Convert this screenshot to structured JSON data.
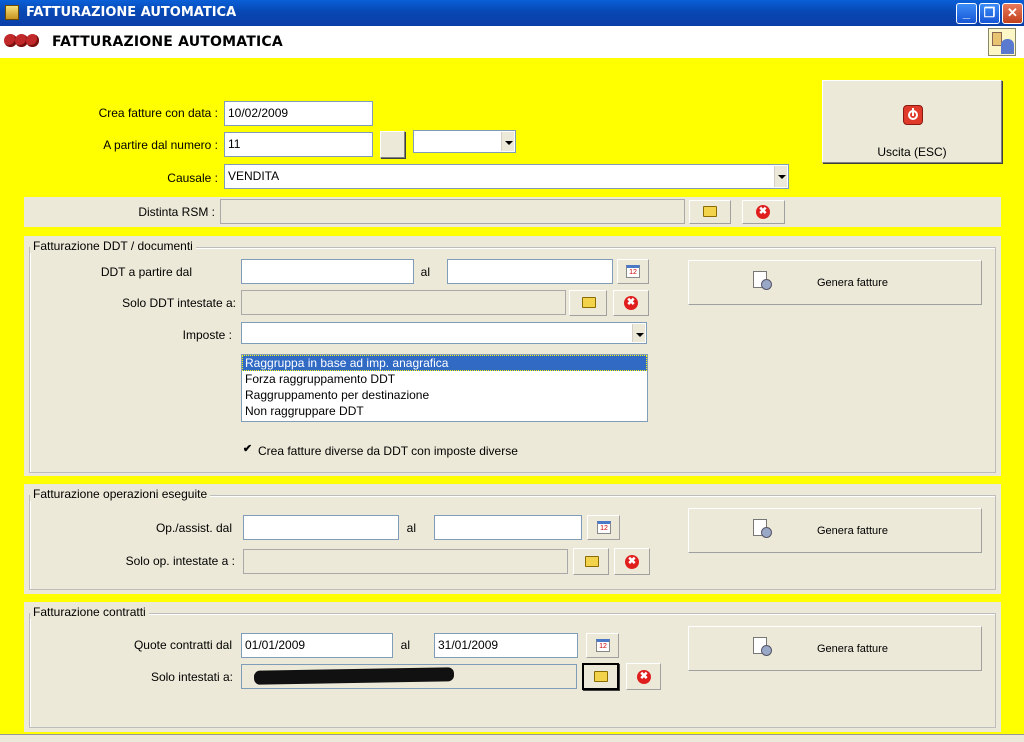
{
  "window": {
    "title": "FATTURAZIONE AUTOMATICA",
    "minimize": "_",
    "maximize": "❐",
    "close": "✕"
  },
  "header": {
    "title": "FATTURAZIONE AUTOMATICA",
    "logo_icon": "strawberries-logo-icon",
    "user_icon": "users-icon"
  },
  "top": {
    "date_label": "Crea fatture con data :",
    "date_value": "10/02/2009",
    "number_label": "A partire dal numero :",
    "number_value": "11",
    "number_suffix_value": "",
    "causale_label": "Causale :",
    "causale_value": "VENDITA",
    "exit_label": "Uscita (ESC)",
    "exit_icon": "power-icon"
  },
  "rsm": {
    "label": "Distinta RSM :",
    "value": ""
  },
  "ddt": {
    "group_title": "Fatturazione DDT / documenti",
    "from_label": "DDT a partire dal",
    "from_value": "",
    "to_label": "al",
    "to_value": "",
    "cal_icon_text": "12",
    "owner_label": "Solo DDT intestate a:",
    "owner_value": "",
    "imposte_label": "Imposte :",
    "imposte_value": "",
    "grouping_options": [
      "Raggruppa in base ad imp. anagrafica",
      "Forza raggruppamento DDT",
      "Raggruppamento per destinazione",
      "Non raggruppare DDT"
    ],
    "grouping_selected": 0,
    "checkbox_label": "Crea fatture diverse da DDT con imposte diverse",
    "checkbox_checked": "✔",
    "generate_label": "Genera fatture"
  },
  "ops": {
    "group_title": "Fatturazione operazioni eseguite",
    "from_label": "Op./assist. dal",
    "from_value": "",
    "to_label": "al",
    "to_value": "",
    "cal_icon_text": "12",
    "owner_label": "Solo op. intestate a :",
    "owner_value": "",
    "generate_label": "Genera fatture"
  },
  "contracts": {
    "group_title": "Fatturazione contratti",
    "from_label": "Quote contratti dal",
    "from_value": "01/01/2009",
    "to_label": "al",
    "to_value": "31/01/2009",
    "cal_icon_text": "12",
    "owner_label": "Solo intestati a:",
    "owner_value": "",
    "generate_label": "Genera fatture"
  },
  "icons": {
    "folder": "folder-icon",
    "delete": "✖",
    "calendar": "calendar-icon",
    "generate": "document-gear-icon"
  }
}
